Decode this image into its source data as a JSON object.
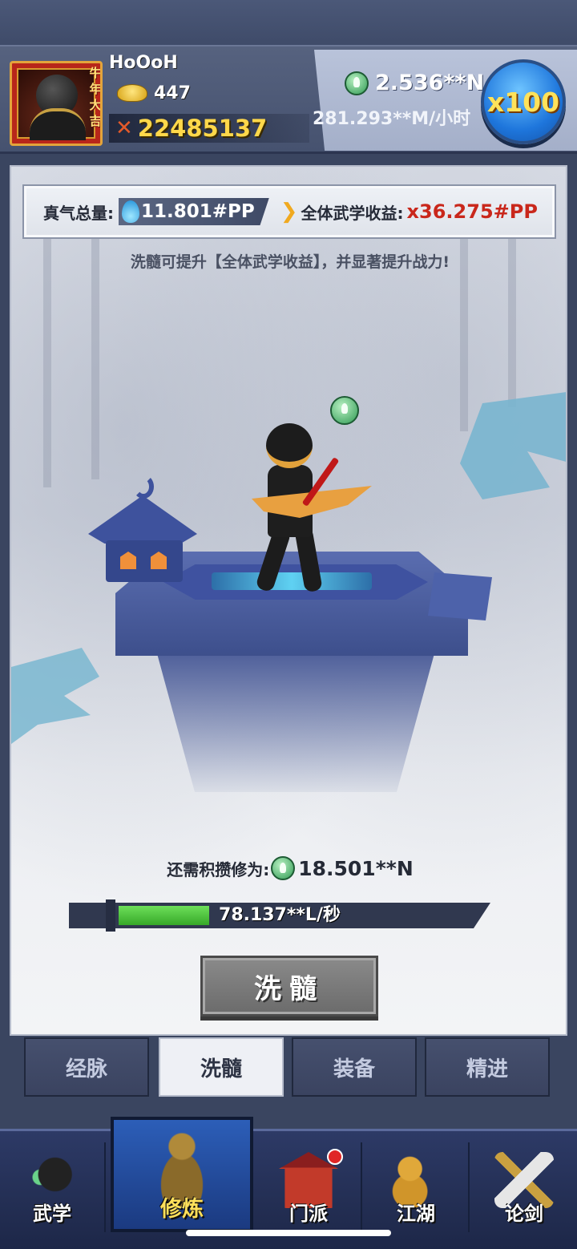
{
  "player": {
    "name": "HoOoH",
    "year_badge": "牛年大吉",
    "gold": "447",
    "power": "22485137"
  },
  "resources": {
    "cultivation": "2.536**N",
    "rate": "281.293**M/小时",
    "multiplier": "x100"
  },
  "qi": {
    "total_label": "真气总量:",
    "total_value": "11.801#PP",
    "gain_label": "全体武学收益:",
    "gain_value": "x36.275#PP"
  },
  "hint": "洗髓可提升【全体武学收益】，并显著提升战力!",
  "requirement": {
    "label": "还需积攒修为:",
    "value": "18.501**N"
  },
  "progress": {
    "text": "78.137**L/秒",
    "fill": 0.26
  },
  "refine_button": "洗髓",
  "sub_tabs": [
    {
      "label": "经脉",
      "active": false
    },
    {
      "label": "洗髓",
      "active": true
    },
    {
      "label": "装备",
      "active": false
    },
    {
      "label": "精进",
      "active": false
    }
  ],
  "bottom_nav": [
    {
      "label": "武学",
      "icon": "stickman-icon",
      "active": false
    },
    {
      "label": "修炼",
      "icon": "meditation-icon",
      "active": true
    },
    {
      "label": "门派",
      "icon": "temple-icon",
      "active": false,
      "badge": true
    },
    {
      "label": "江湖",
      "icon": "gourd-icon",
      "active": false
    },
    {
      "label": "论剑",
      "icon": "sword-icon",
      "active": false
    }
  ],
  "colors": {
    "gain_red": "#c9271b",
    "power_gold": "#ffd84a",
    "progress_green": "#36a829",
    "multiplier_blue": "#1e76dc"
  }
}
